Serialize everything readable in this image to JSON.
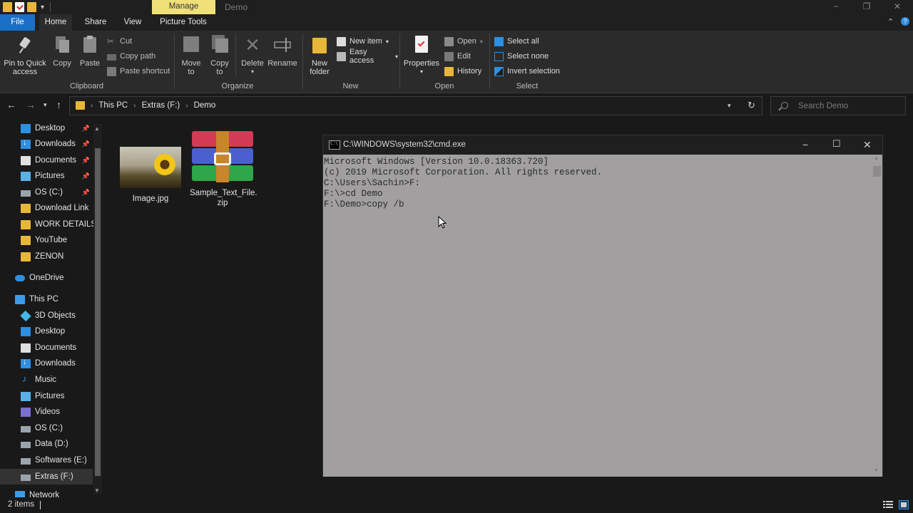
{
  "titlebar": {
    "contextual_tab": "Manage",
    "window_title": "Demo",
    "minimize": "−",
    "maximize": "❐",
    "close": "✕"
  },
  "tabs": {
    "file": "File",
    "home": "Home",
    "share": "Share",
    "view": "View",
    "picture_tools": "Picture Tools",
    "collapse": "⌃",
    "help": "?"
  },
  "ribbon": {
    "clipboard": {
      "label": "Clipboard",
      "pin_line1": "Pin to Quick",
      "pin_line2": "access",
      "copy": "Copy",
      "paste": "Paste",
      "cut": "Cut",
      "copy_path": "Copy path",
      "paste_shortcut": "Paste shortcut"
    },
    "organize": {
      "label": "Organize",
      "move_to_line1": "Move",
      "move_to_line2": "to",
      "copy_to_line1": "Copy",
      "copy_to_line2": "to",
      "delete": "Delete",
      "rename": "Rename"
    },
    "new": {
      "label": "New",
      "new_folder_line1": "New",
      "new_folder_line2": "folder",
      "new_item": "New item",
      "easy_access": "Easy access"
    },
    "open": {
      "label": "Open",
      "properties": "Properties",
      "open": "Open",
      "edit": "Edit",
      "history": "History"
    },
    "select": {
      "label": "Select",
      "select_all": "Select all",
      "select_none": "Select none",
      "invert_selection": "Invert selection"
    }
  },
  "address": {
    "crumbs": [
      "This PC",
      "Extras (F:)",
      "Demo"
    ],
    "search_placeholder": "Search Demo"
  },
  "nav": {
    "quick_access": [
      {
        "label": "Desktop",
        "icon": "desktop-icon"
      },
      {
        "label": "Downloads",
        "icon": "downloads-icon"
      },
      {
        "label": "Documents",
        "icon": "documents-icon"
      },
      {
        "label": "Pictures",
        "icon": "pictures-icon"
      },
      {
        "label": "OS (C:)",
        "icon": "drive-icon"
      },
      {
        "label": "Download Link",
        "icon": "folder-icon"
      },
      {
        "label": "WORK DETAILS (",
        "icon": "folder-icon"
      },
      {
        "label": "YouTube",
        "icon": "folder-icon"
      },
      {
        "label": "ZENON",
        "icon": "folder-icon"
      }
    ],
    "onedrive": "OneDrive",
    "this_pc": "This PC",
    "this_pc_items": [
      {
        "label": "3D Objects",
        "icon": "3d-objects-icon"
      },
      {
        "label": "Desktop",
        "icon": "desktop-icon"
      },
      {
        "label": "Documents",
        "icon": "documents-icon"
      },
      {
        "label": "Downloads",
        "icon": "downloads-icon"
      },
      {
        "label": "Music",
        "icon": "music-icon"
      },
      {
        "label": "Pictures",
        "icon": "pictures-icon"
      },
      {
        "label": "Videos",
        "icon": "videos-icon"
      },
      {
        "label": "OS (C:)",
        "icon": "drive-icon"
      },
      {
        "label": "Data (D:)",
        "icon": "drive-icon"
      },
      {
        "label": "Softwares (E:)",
        "icon": "drive-icon"
      },
      {
        "label": "Extras (F:)",
        "icon": "drive-icon"
      }
    ],
    "network": "Network"
  },
  "files": [
    {
      "name": "Image.jpg",
      "type": "image"
    },
    {
      "name_line1": "Sample_Text_File.",
      "name_line2": "zip",
      "type": "zip"
    }
  ],
  "cmd": {
    "title": "C:\\WINDOWS\\system32\\cmd.exe",
    "lines": [
      "Microsoft Windows [Version 10.0.18363.720]",
      "(c) 2019 Microsoft Corporation. All rights reserved.",
      "",
      "C:\\Users\\Sachin>F:",
      "",
      "F:\\>cd Demo",
      "",
      "F:\\Demo>copy /b"
    ]
  },
  "status": {
    "items_count": "2 items"
  },
  "colors": {
    "accent": "#1a6fc7",
    "manage_tab": "#f0e07a",
    "folder": "#e8b73a",
    "console_bg": "#a19fa0"
  }
}
